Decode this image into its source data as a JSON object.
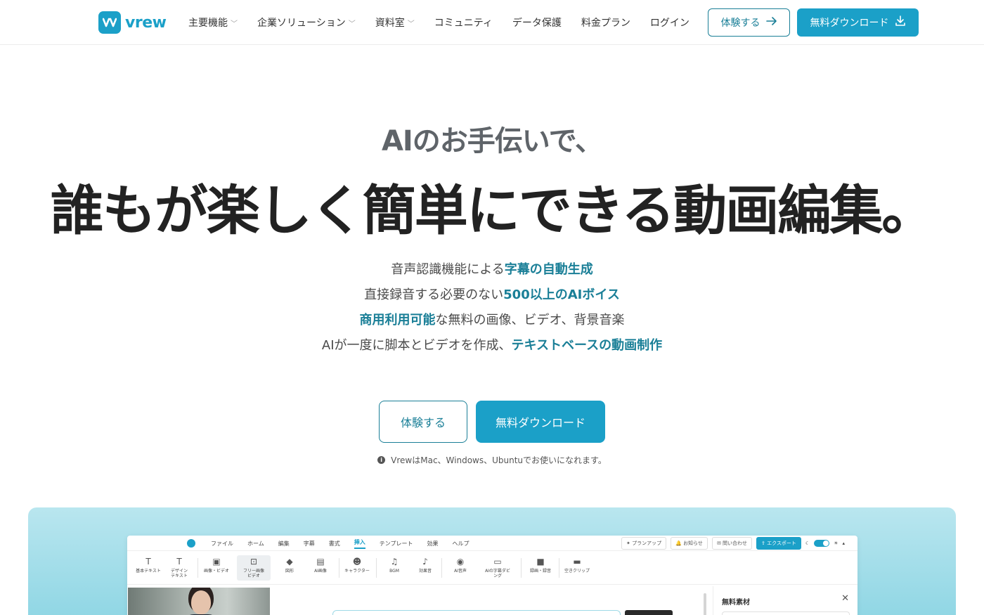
{
  "nav": {
    "logo_text": "vrew",
    "items": [
      {
        "label": "主要機能",
        "has_dropdown": true
      },
      {
        "label": "企業ソリューション",
        "has_dropdown": true
      },
      {
        "label": "資料室",
        "has_dropdown": true
      },
      {
        "label": "コミュニティ",
        "has_dropdown": false
      },
      {
        "label": "データ保護",
        "has_dropdown": false
      },
      {
        "label": "料金プラン",
        "has_dropdown": false
      },
      {
        "label": "ログイン",
        "has_dropdown": false
      }
    ],
    "try_label": "体験する",
    "download_label": "無料ダウンロード"
  },
  "hero": {
    "subtitle": "AIのお手伝いで、",
    "title": "誰もが楽しく簡単にできる動画編集。",
    "features": [
      {
        "pre": "音声認識機能による",
        "hl": "字幕の自動生成",
        "post": ""
      },
      {
        "pre": "直接録音する必要のない",
        "hl": "500以上のAIボイス",
        "post": ""
      },
      {
        "pre": "",
        "hl": "商用利用可能",
        "post": "な無料の画像、ビデオ、背景音楽"
      },
      {
        "pre": "AIが一度に脚本とビデオを作成、",
        "hl": "テキストベースの動画制作",
        "post": ""
      }
    ],
    "try_label": "体験する",
    "download_label": "無料ダウンロード",
    "os_note": "VrewはMac、Windows、Ubuntuでお使いになれます。"
  },
  "app": {
    "menu": [
      "ファイル",
      "ホーム",
      "編集",
      "字幕",
      "書式",
      "挿入",
      "テンプレート",
      "効果",
      "ヘルプ"
    ],
    "active_menu": "挿入",
    "right": {
      "plan_up": "プランアップ",
      "notify": "お知らせ",
      "contact": "問い合わせ",
      "export": "エクスポート"
    },
    "tools": [
      {
        "label": "基本テキスト",
        "icon": "T"
      },
      {
        "label": "デザイン\nテキスト",
        "icon": "T"
      },
      {
        "label": "画像・ビデオ",
        "icon": "▣"
      },
      {
        "label": "フリー画像\nビデオ",
        "icon": "⊡"
      },
      {
        "label": "図形",
        "icon": "◆"
      },
      {
        "label": "AI画像",
        "icon": "▤"
      },
      {
        "label": "キャラクター",
        "icon": "☻"
      },
      {
        "label": "BGM",
        "icon": "♫"
      },
      {
        "label": "効果音",
        "icon": "♪"
      },
      {
        "label": "AI音声",
        "icon": "◉"
      },
      {
        "label": "AIの字幕ダビ\nング",
        "icon": "▭"
      },
      {
        "label": "録画・録音",
        "icon": "■"
      },
      {
        "label": "空きクリップ",
        "icon": "▬"
      }
    ],
    "side_panel_title": "無料素材"
  },
  "colors": {
    "brand": "#1ba0c8",
    "highlight": "#1a7f97",
    "title": "#222222",
    "subtitle": "#5f6469"
  }
}
